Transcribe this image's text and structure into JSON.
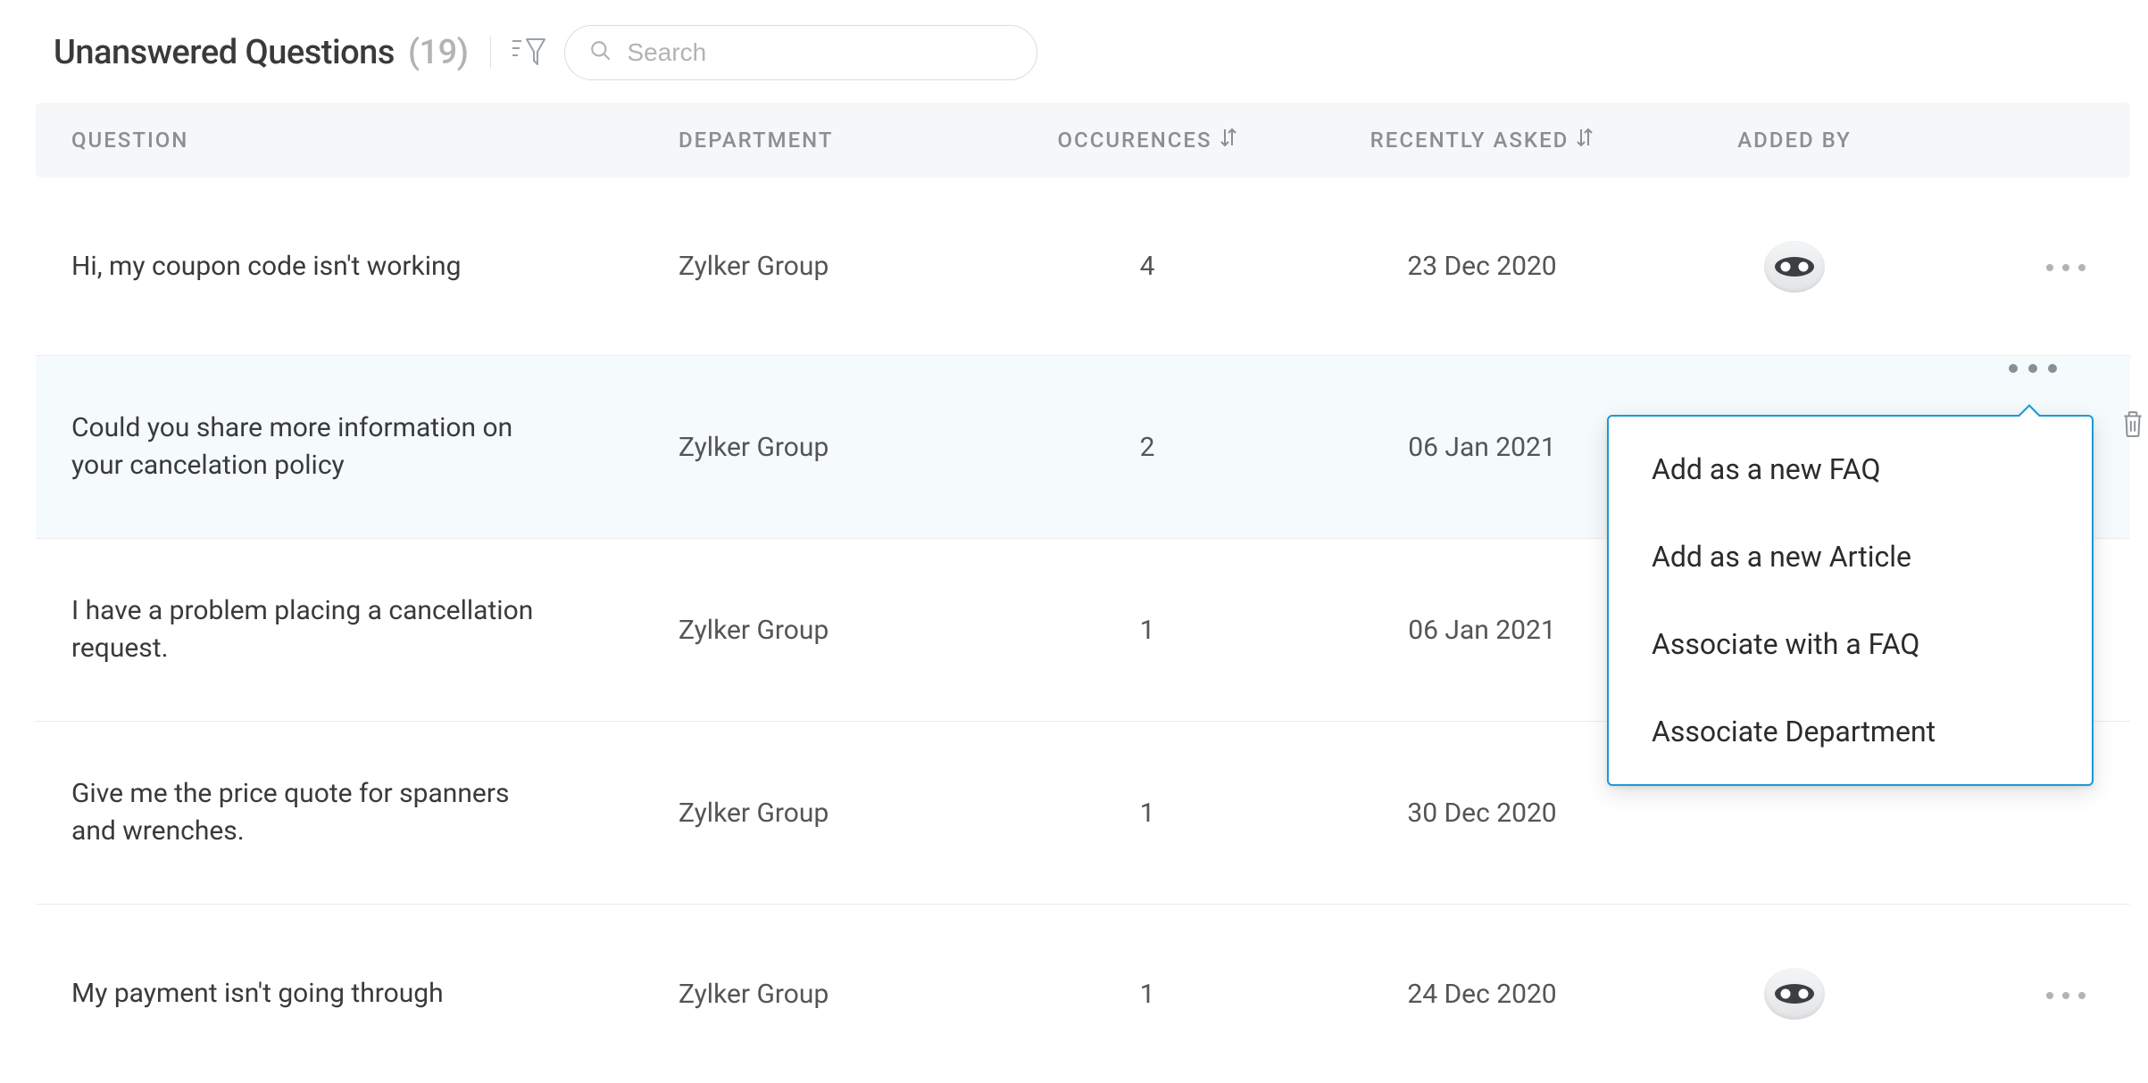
{
  "header": {
    "title": "Unanswered Questions",
    "count": "(19)",
    "search_placeholder": "Search"
  },
  "columns": {
    "question": "QUESTION",
    "department": "DEPARTMENT",
    "occurrences": "OCCURENCES",
    "recently_asked": "RECENTLY ASKED",
    "added_by": "ADDED BY"
  },
  "rows": [
    {
      "question": "Hi, my coupon code isn't working",
      "department": "Zylker Group",
      "occurrences": "4",
      "recently_asked": "23 Dec 2020"
    },
    {
      "question": "Could you share more information on your cancelation policy",
      "department": "Zylker Group",
      "occurrences": "2",
      "recently_asked": "06 Jan 2021"
    },
    {
      "question": "I have a problem placing a cancellation request.",
      "department": "Zylker Group",
      "occurrences": "1",
      "recently_asked": "06 Jan 2021"
    },
    {
      "question": "Give me the price quote for spanners and wrenches.",
      "department": "Zylker Group",
      "occurrences": "1",
      "recently_asked": "30 Dec 2020"
    },
    {
      "question": "My payment isn't going through",
      "department": "Zylker Group",
      "occurrences": "1",
      "recently_asked": "24 Dec 2020"
    }
  ],
  "menu": {
    "items": [
      "Add as a new FAQ",
      "Add as a new Article",
      "Associate with a FAQ",
      "Associate Department"
    ]
  }
}
